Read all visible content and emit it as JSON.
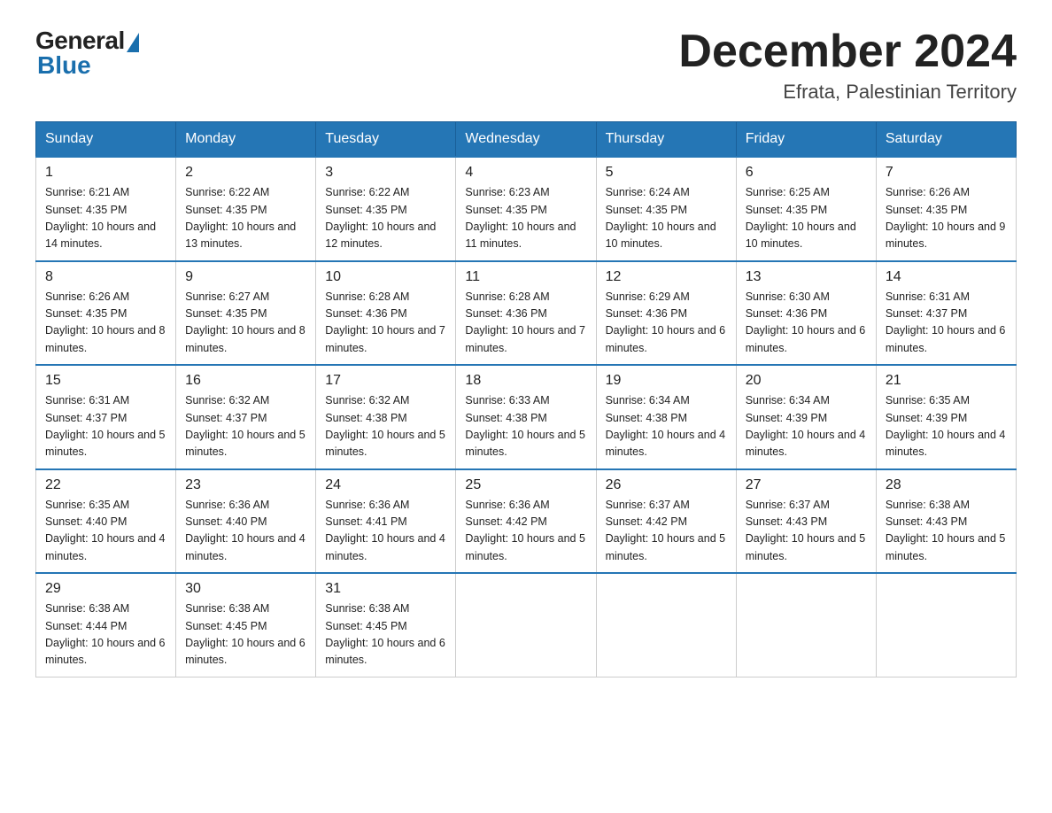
{
  "logo": {
    "general": "General",
    "blue": "Blue"
  },
  "title": {
    "month_year": "December 2024",
    "location": "Efrata, Palestinian Territory"
  },
  "days_of_week": [
    "Sunday",
    "Monday",
    "Tuesday",
    "Wednesday",
    "Thursday",
    "Friday",
    "Saturday"
  ],
  "weeks": [
    [
      {
        "day": 1,
        "sunrise": "6:21 AM",
        "sunset": "4:35 PM",
        "daylight": "10 hours and 14 minutes."
      },
      {
        "day": 2,
        "sunrise": "6:22 AM",
        "sunset": "4:35 PM",
        "daylight": "10 hours and 13 minutes."
      },
      {
        "day": 3,
        "sunrise": "6:22 AM",
        "sunset": "4:35 PM",
        "daylight": "10 hours and 12 minutes."
      },
      {
        "day": 4,
        "sunrise": "6:23 AM",
        "sunset": "4:35 PM",
        "daylight": "10 hours and 11 minutes."
      },
      {
        "day": 5,
        "sunrise": "6:24 AM",
        "sunset": "4:35 PM",
        "daylight": "10 hours and 10 minutes."
      },
      {
        "day": 6,
        "sunrise": "6:25 AM",
        "sunset": "4:35 PM",
        "daylight": "10 hours and 10 minutes."
      },
      {
        "day": 7,
        "sunrise": "6:26 AM",
        "sunset": "4:35 PM",
        "daylight": "10 hours and 9 minutes."
      }
    ],
    [
      {
        "day": 8,
        "sunrise": "6:26 AM",
        "sunset": "4:35 PM",
        "daylight": "10 hours and 8 minutes."
      },
      {
        "day": 9,
        "sunrise": "6:27 AM",
        "sunset": "4:35 PM",
        "daylight": "10 hours and 8 minutes."
      },
      {
        "day": 10,
        "sunrise": "6:28 AM",
        "sunset": "4:36 PM",
        "daylight": "10 hours and 7 minutes."
      },
      {
        "day": 11,
        "sunrise": "6:28 AM",
        "sunset": "4:36 PM",
        "daylight": "10 hours and 7 minutes."
      },
      {
        "day": 12,
        "sunrise": "6:29 AM",
        "sunset": "4:36 PM",
        "daylight": "10 hours and 6 minutes."
      },
      {
        "day": 13,
        "sunrise": "6:30 AM",
        "sunset": "4:36 PM",
        "daylight": "10 hours and 6 minutes."
      },
      {
        "day": 14,
        "sunrise": "6:31 AM",
        "sunset": "4:37 PM",
        "daylight": "10 hours and 6 minutes."
      }
    ],
    [
      {
        "day": 15,
        "sunrise": "6:31 AM",
        "sunset": "4:37 PM",
        "daylight": "10 hours and 5 minutes."
      },
      {
        "day": 16,
        "sunrise": "6:32 AM",
        "sunset": "4:37 PM",
        "daylight": "10 hours and 5 minutes."
      },
      {
        "day": 17,
        "sunrise": "6:32 AM",
        "sunset": "4:38 PM",
        "daylight": "10 hours and 5 minutes."
      },
      {
        "day": 18,
        "sunrise": "6:33 AM",
        "sunset": "4:38 PM",
        "daylight": "10 hours and 5 minutes."
      },
      {
        "day": 19,
        "sunrise": "6:34 AM",
        "sunset": "4:38 PM",
        "daylight": "10 hours and 4 minutes."
      },
      {
        "day": 20,
        "sunrise": "6:34 AM",
        "sunset": "4:39 PM",
        "daylight": "10 hours and 4 minutes."
      },
      {
        "day": 21,
        "sunrise": "6:35 AM",
        "sunset": "4:39 PM",
        "daylight": "10 hours and 4 minutes."
      }
    ],
    [
      {
        "day": 22,
        "sunrise": "6:35 AM",
        "sunset": "4:40 PM",
        "daylight": "10 hours and 4 minutes."
      },
      {
        "day": 23,
        "sunrise": "6:36 AM",
        "sunset": "4:40 PM",
        "daylight": "10 hours and 4 minutes."
      },
      {
        "day": 24,
        "sunrise": "6:36 AM",
        "sunset": "4:41 PM",
        "daylight": "10 hours and 4 minutes."
      },
      {
        "day": 25,
        "sunrise": "6:36 AM",
        "sunset": "4:42 PM",
        "daylight": "10 hours and 5 minutes."
      },
      {
        "day": 26,
        "sunrise": "6:37 AM",
        "sunset": "4:42 PM",
        "daylight": "10 hours and 5 minutes."
      },
      {
        "day": 27,
        "sunrise": "6:37 AM",
        "sunset": "4:43 PM",
        "daylight": "10 hours and 5 minutes."
      },
      {
        "day": 28,
        "sunrise": "6:38 AM",
        "sunset": "4:43 PM",
        "daylight": "10 hours and 5 minutes."
      }
    ],
    [
      {
        "day": 29,
        "sunrise": "6:38 AM",
        "sunset": "4:44 PM",
        "daylight": "10 hours and 6 minutes."
      },
      {
        "day": 30,
        "sunrise": "6:38 AM",
        "sunset": "4:45 PM",
        "daylight": "10 hours and 6 minutes."
      },
      {
        "day": 31,
        "sunrise": "6:38 AM",
        "sunset": "4:45 PM",
        "daylight": "10 hours and 6 minutes."
      },
      null,
      null,
      null,
      null
    ]
  ]
}
